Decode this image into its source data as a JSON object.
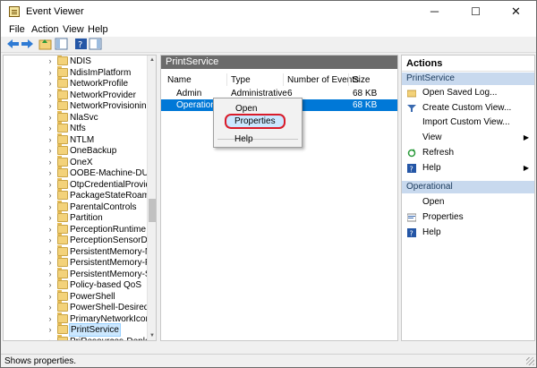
{
  "window": {
    "title": "Event Viewer",
    "minimize": "─",
    "maximize": "☐",
    "close": "✕"
  },
  "menu": [
    "File",
    "Action",
    "View",
    "Help"
  ],
  "tree": {
    "items": [
      "NDIS",
      "NdisImPlatform",
      "NetworkProfile",
      "NetworkProvider",
      "NetworkProvisioning",
      "NlaSvc",
      "Ntfs",
      "NTLM",
      "OneBackup",
      "OneX",
      "OOBE-Machine-DUI",
      "OtpCredentialProvider",
      "PackageStateRoaming",
      "ParentalControls",
      "Partition",
      "PerceptionRuntime",
      "PerceptionSensorDataSe",
      "PersistentMemory-Nvdi",
      "PersistentMemory-Pmer",
      "PersistentMemory-ScmE",
      "Policy-based QoS",
      "PowerShell",
      "PowerShell-DesiredState",
      "PrimaryNetworkIcon",
      "PrintService",
      "PriResources-Deployme"
    ],
    "selected_index": 24
  },
  "middle": {
    "header": "PrintService",
    "columns": [
      "Name",
      "Type",
      "Number of Events",
      "Size"
    ],
    "rows": [
      {
        "name": "Admin",
        "type": "Administrative",
        "events": "6",
        "size": "68 KB"
      },
      {
        "name": "Operational",
        "type": "",
        "events": "",
        "size": "68 KB"
      }
    ]
  },
  "context_menu": {
    "items": [
      "Open",
      "Properties",
      "Help"
    ]
  },
  "actions": {
    "title": "Actions",
    "section1": "PrintService",
    "section1_items": [
      "Open Saved Log...",
      "Create Custom View...",
      "Import Custom View...",
      "View",
      "Refresh",
      "Help"
    ],
    "section2": "Operational",
    "section2_items": [
      "Open",
      "Properties",
      "Help"
    ]
  },
  "status": "Shows properties.",
  "colors": {
    "selection": "#0078d7",
    "section_bg": "#c8d9ee",
    "header_bg": "#6b6b6b",
    "oval": "#d91c2a"
  }
}
